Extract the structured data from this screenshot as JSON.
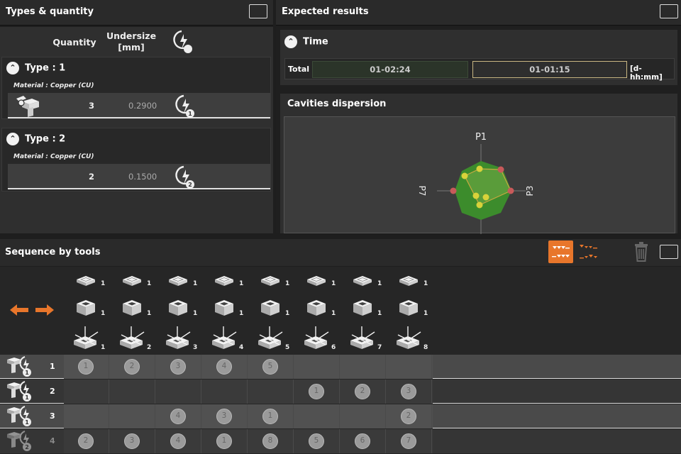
{
  "left_panel": {
    "title": "Types & quantity"
  },
  "columns": {
    "quantity": "Quantity",
    "undersize": "Undersize",
    "undersize_unit": "[mm]"
  },
  "types": [
    {
      "title": "Type : 1",
      "material": "Material : Copper (CU)",
      "quantity": "3",
      "undersize": "0.2900",
      "badge": "1"
    },
    {
      "title": "Type : 2",
      "material": "Material : Copper (CU)",
      "quantity": "2",
      "undersize": "0.1500",
      "badge": "2"
    }
  ],
  "right_panel": {
    "title": "Expected results"
  },
  "time": {
    "title": "Time",
    "total_label": "Total",
    "value1": "01-02:24",
    "value2": "01-01:15",
    "unit": "[d-hh:mm]"
  },
  "dispersion": {
    "title": "Cavities dispersion",
    "axis_top": "P1",
    "axis_left": "P7",
    "axis_right": "P3"
  },
  "sequence": {
    "title": "Sequence by tools",
    "columns": [
      {
        "a": "1",
        "b": "1",
        "c": "1"
      },
      {
        "a": "1",
        "b": "1",
        "c": "2"
      },
      {
        "a": "1",
        "b": "1",
        "c": "3"
      },
      {
        "a": "1",
        "b": "1",
        "c": "4"
      },
      {
        "a": "1",
        "b": "1",
        "c": "5"
      },
      {
        "a": "1",
        "b": "1",
        "c": "6"
      },
      {
        "a": "1",
        "b": "1",
        "c": "7"
      },
      {
        "a": "1",
        "b": "1",
        "c": "8"
      }
    ],
    "rows": [
      {
        "label": "1",
        "badge": "1",
        "cells": [
          "1",
          "2",
          "3",
          "4",
          "5",
          "",
          "",
          ""
        ]
      },
      {
        "label": "2",
        "badge": "1",
        "cells": [
          "",
          "",
          "",
          "",
          "",
          "1",
          "2",
          "3"
        ]
      },
      {
        "label": "3",
        "badge": "1",
        "cells": [
          "",
          "",
          "4",
          "3",
          "1",
          "",
          "",
          "2"
        ]
      },
      {
        "label": "4",
        "badge": "2",
        "cells": [
          "2",
          "3",
          "4",
          "1",
          "8",
          "5",
          "6",
          "7"
        ]
      }
    ]
  },
  "colors": {
    "accent": "#e8762b",
    "chart_green": "#3c8c2c",
    "point_yellow": "#d8d23a",
    "point_red": "#c85a5a"
  }
}
